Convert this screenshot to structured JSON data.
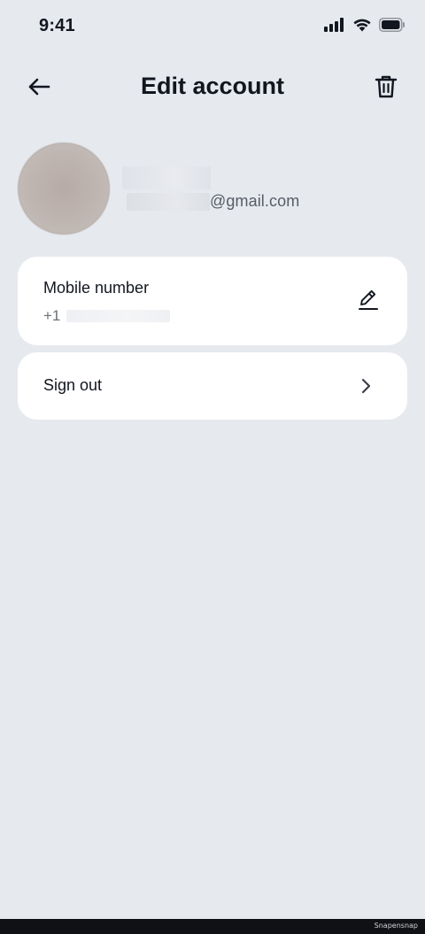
{
  "status_bar": {
    "time": "9:41",
    "icons": [
      "signal-icon",
      "wifi-icon",
      "battery-icon"
    ]
  },
  "header": {
    "title": "Edit account",
    "back_icon": "arrow-left-icon",
    "delete_icon": "trash-icon"
  },
  "profile": {
    "email_domain": "@gmail.com"
  },
  "cards": {
    "phone": {
      "label": "Mobile number",
      "prefix": "+1",
      "edit_icon": "pencil-icon"
    },
    "signout": {
      "label": "Sign out",
      "chevron_icon": "chevron-right-icon"
    }
  },
  "footer": {
    "watermark": "Snapensnap"
  },
  "colors": {
    "background": "#e6e9ee",
    "card": "#ffffff",
    "text": "#12161f",
    "muted": "#6b707a"
  }
}
